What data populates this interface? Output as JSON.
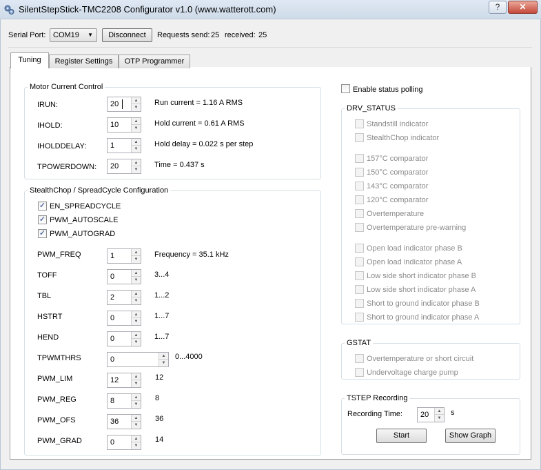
{
  "window": {
    "title": "SilentStepStick-TMC2208 Configurator v1.0 (www.watterott.com)",
    "minimize_glyph": "?",
    "close_glyph": "✕"
  },
  "connection": {
    "serial_port_label": "Serial Port:",
    "port_value": "COM19",
    "disconnect_label": "Disconnect",
    "requests_label": "Requests send:",
    "requests_value": "25",
    "received_label": "received:",
    "received_value": "25"
  },
  "tabs": [
    "Tuning",
    "Register Settings",
    "OTP Programmer"
  ],
  "motor_current": {
    "title": "Motor Current Control",
    "rows": [
      {
        "label": "IRUN:",
        "value": "20",
        "info": "Run current = 1.16 A RMS"
      },
      {
        "label": "IHOLD:",
        "value": "10",
        "info": "Hold current = 0.61 A RMS"
      },
      {
        "label": "IHOLDDELAY:",
        "value": "1",
        "info": "Hold delay = 0.022 s per step"
      },
      {
        "label": "TPOWERDOWN:",
        "value": "20",
        "info": "Time = 0.437 s"
      }
    ]
  },
  "stealthchop": {
    "title": "StealthChop / SpreadCycle Configuration",
    "checkboxes": [
      {
        "label": "EN_SPREADCYCLE",
        "checked": true
      },
      {
        "label": "PWM_AUTOSCALE",
        "checked": true
      },
      {
        "label": "PWM_AUTOGRAD",
        "checked": true
      }
    ],
    "rows": [
      {
        "label": "PWM_FREQ",
        "value": "1",
        "info": "Frequency = 35.1 kHz"
      },
      {
        "label": "TOFF",
        "value": "0",
        "info": "3...4"
      },
      {
        "label": "TBL",
        "value": "2",
        "info": "1...2"
      },
      {
        "label": "HSTRT",
        "value": "0",
        "info": "1...7"
      },
      {
        "label": "HEND",
        "value": "0",
        "info": "1...7"
      },
      {
        "label": "TPWMTHRS",
        "value": "0",
        "info": "0...4000"
      },
      {
        "label": "PWM_LIM",
        "value": "12",
        "info": "12"
      },
      {
        "label": "PWM_REG",
        "value": "8",
        "info": "8"
      },
      {
        "label": "PWM_OFS",
        "value": "36",
        "info": "36"
      },
      {
        "label": "PWM_GRAD",
        "value": "0",
        "info": "14"
      }
    ]
  },
  "polling": {
    "label": "Enable status polling",
    "checked": false
  },
  "drv_status": {
    "title": "DRV_STATUS",
    "items": [
      "Standstill indicator",
      "StealthChop indicator",
      "157°C comparator",
      "150°C comparator",
      "143°C comparator",
      "120°C comparator",
      "Overtemperature",
      "Overtemperature pre-warning",
      "Open load indicator phase B",
      "Open load indicator phase A",
      "Low side short indicator phase B",
      "Low side short indicator phase A",
      "Short to ground indicator phase B",
      "Short to ground indicator phase A"
    ]
  },
  "gstat": {
    "title": "GSTAT",
    "items": [
      "Overtemperature or short circuit",
      "Undervoltage charge pump"
    ]
  },
  "tstep": {
    "title": "TSTEP Recording",
    "recording_label": "Recording Time:",
    "recording_value": "20",
    "unit": "s",
    "start_label": "Start",
    "graph_label": "Show Graph"
  }
}
